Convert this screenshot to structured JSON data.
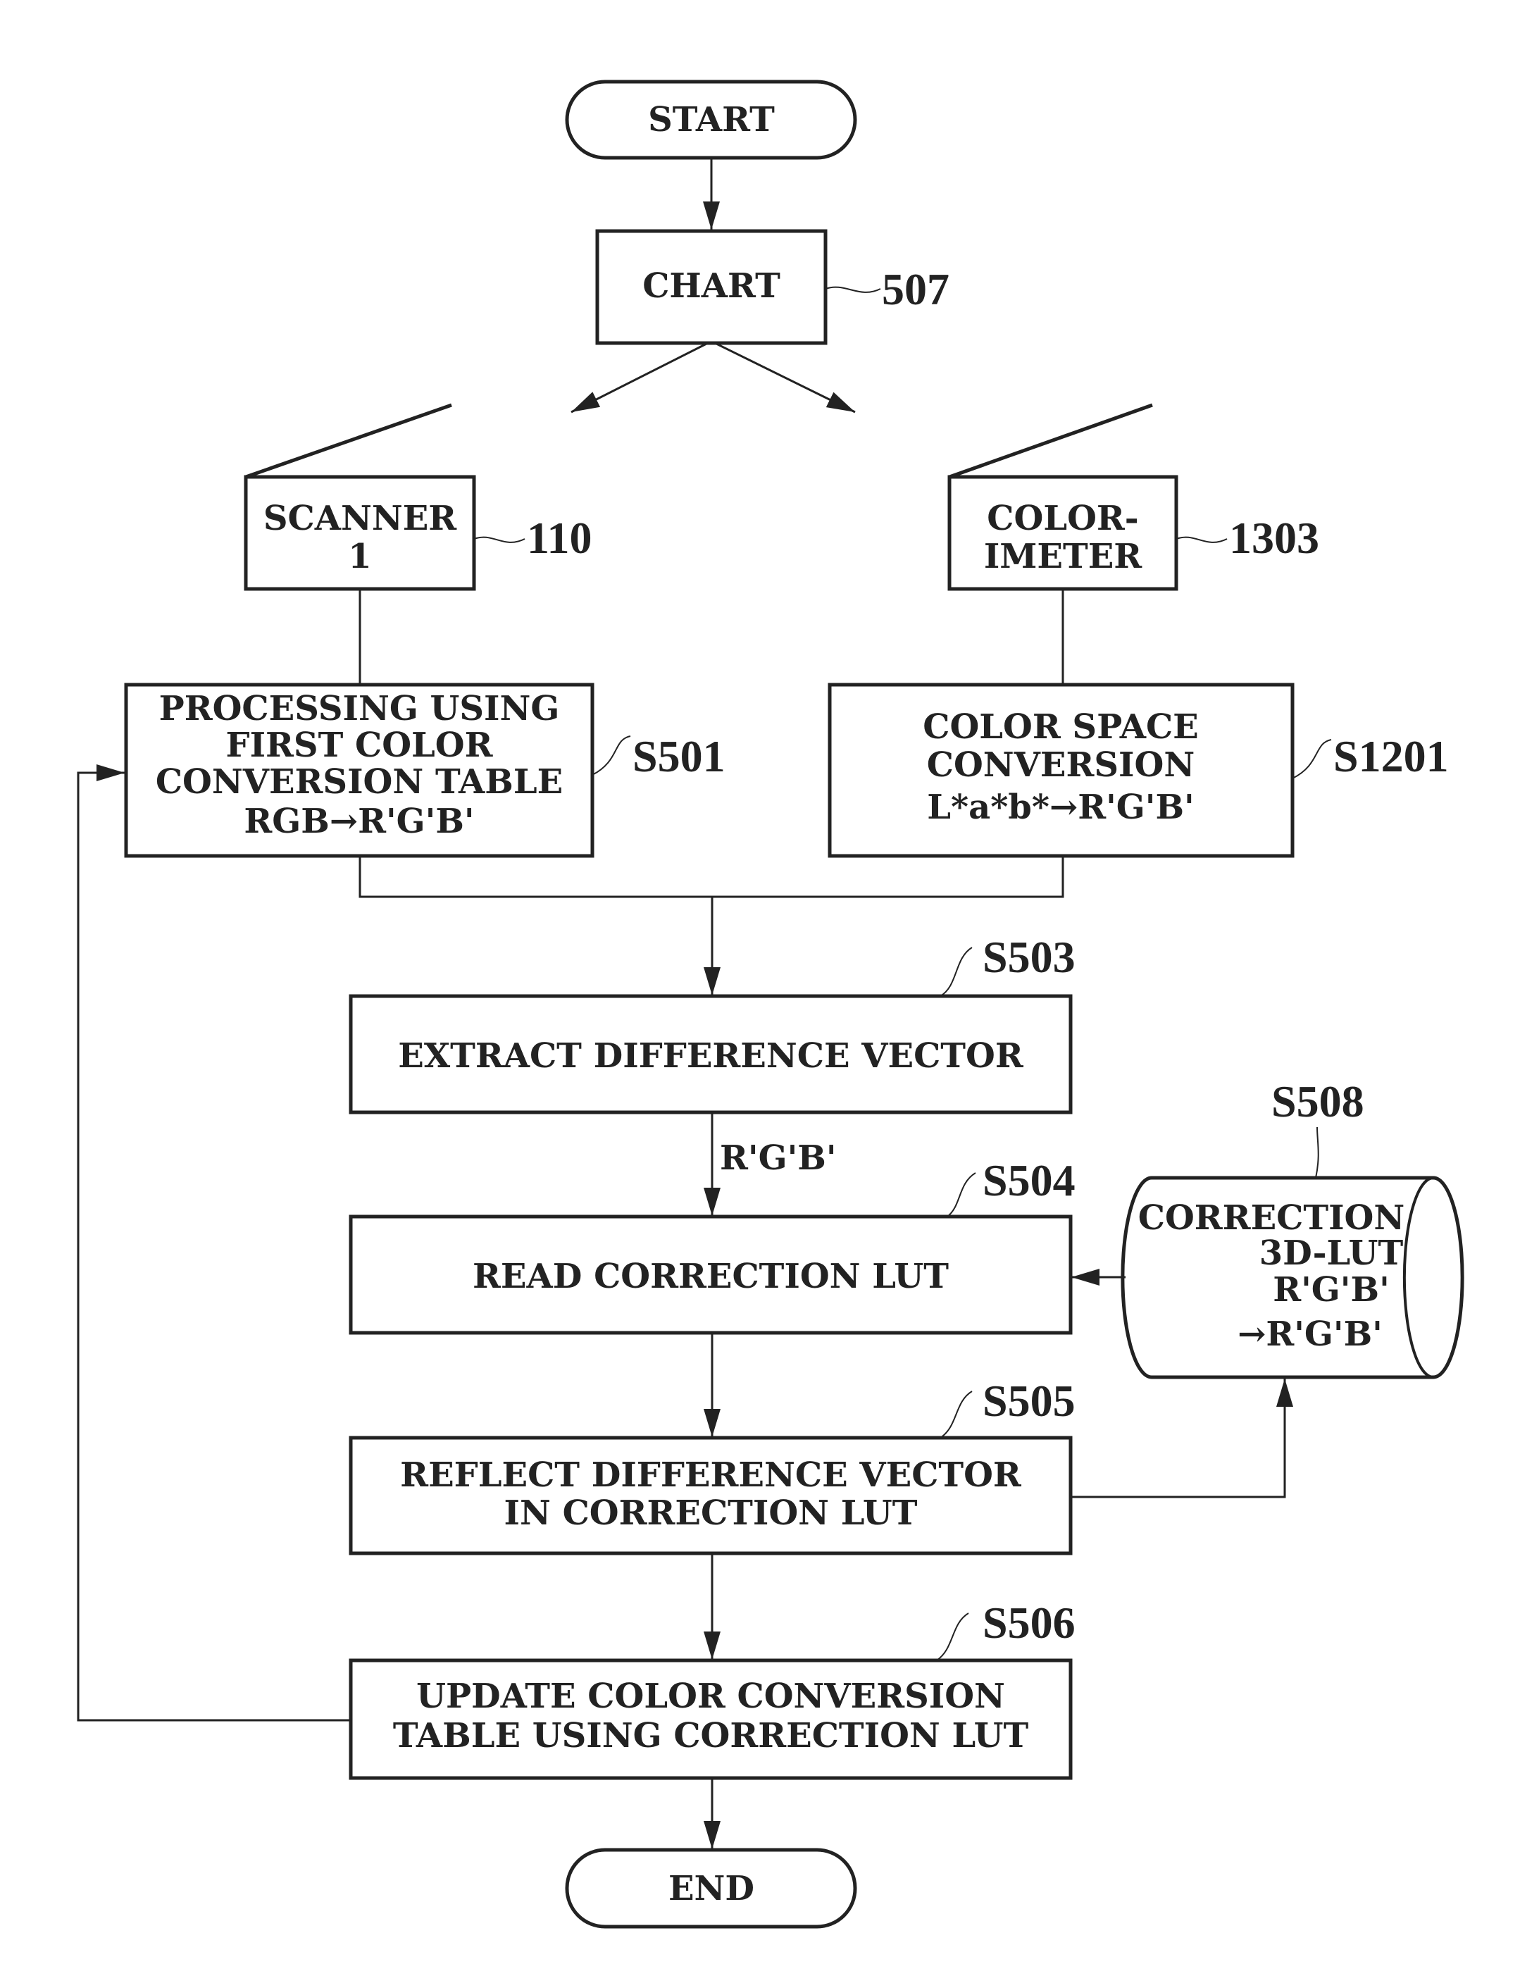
{
  "nodes": {
    "start": {
      "label": "START"
    },
    "chart": {
      "label": "CHART",
      "ref": "507"
    },
    "scanner": {
      "lines": [
        "SCANNER",
        "1"
      ],
      "ref": "110"
    },
    "colorimeter": {
      "lines": [
        "COLOR-",
        "IMETER"
      ],
      "ref": "1303"
    },
    "s501": {
      "lines": [
        "PROCESSING USING",
        "FIRST COLOR",
        "CONVERSION TABLE",
        "RGB→R'G'B'"
      ],
      "ref": "S501"
    },
    "s1201": {
      "lines": [
        "COLOR SPACE",
        "CONVERSION",
        "L*a*b*→R'G'B'"
      ],
      "ref": "S1201"
    },
    "s503": {
      "lines": [
        "EXTRACT DIFFERENCE VECTOR"
      ],
      "ref": "S503"
    },
    "edge_label": "R'G'B'",
    "s504": {
      "lines": [
        "READ CORRECTION LUT"
      ],
      "ref": "S504"
    },
    "s508": {
      "lines": [
        "CORRECTION",
        "3D-LUT",
        "R'G'B'",
        "→R'G'B'"
      ],
      "ref": "S508"
    },
    "s505": {
      "lines": [
        "REFLECT DIFFERENCE VECTOR",
        "IN CORRECTION LUT"
      ],
      "ref": "S505"
    },
    "s506": {
      "lines": [
        "UPDATE COLOR CONVERSION",
        "TABLE USING CORRECTION LUT"
      ],
      "ref": "S506"
    },
    "end": {
      "label": "END"
    }
  }
}
